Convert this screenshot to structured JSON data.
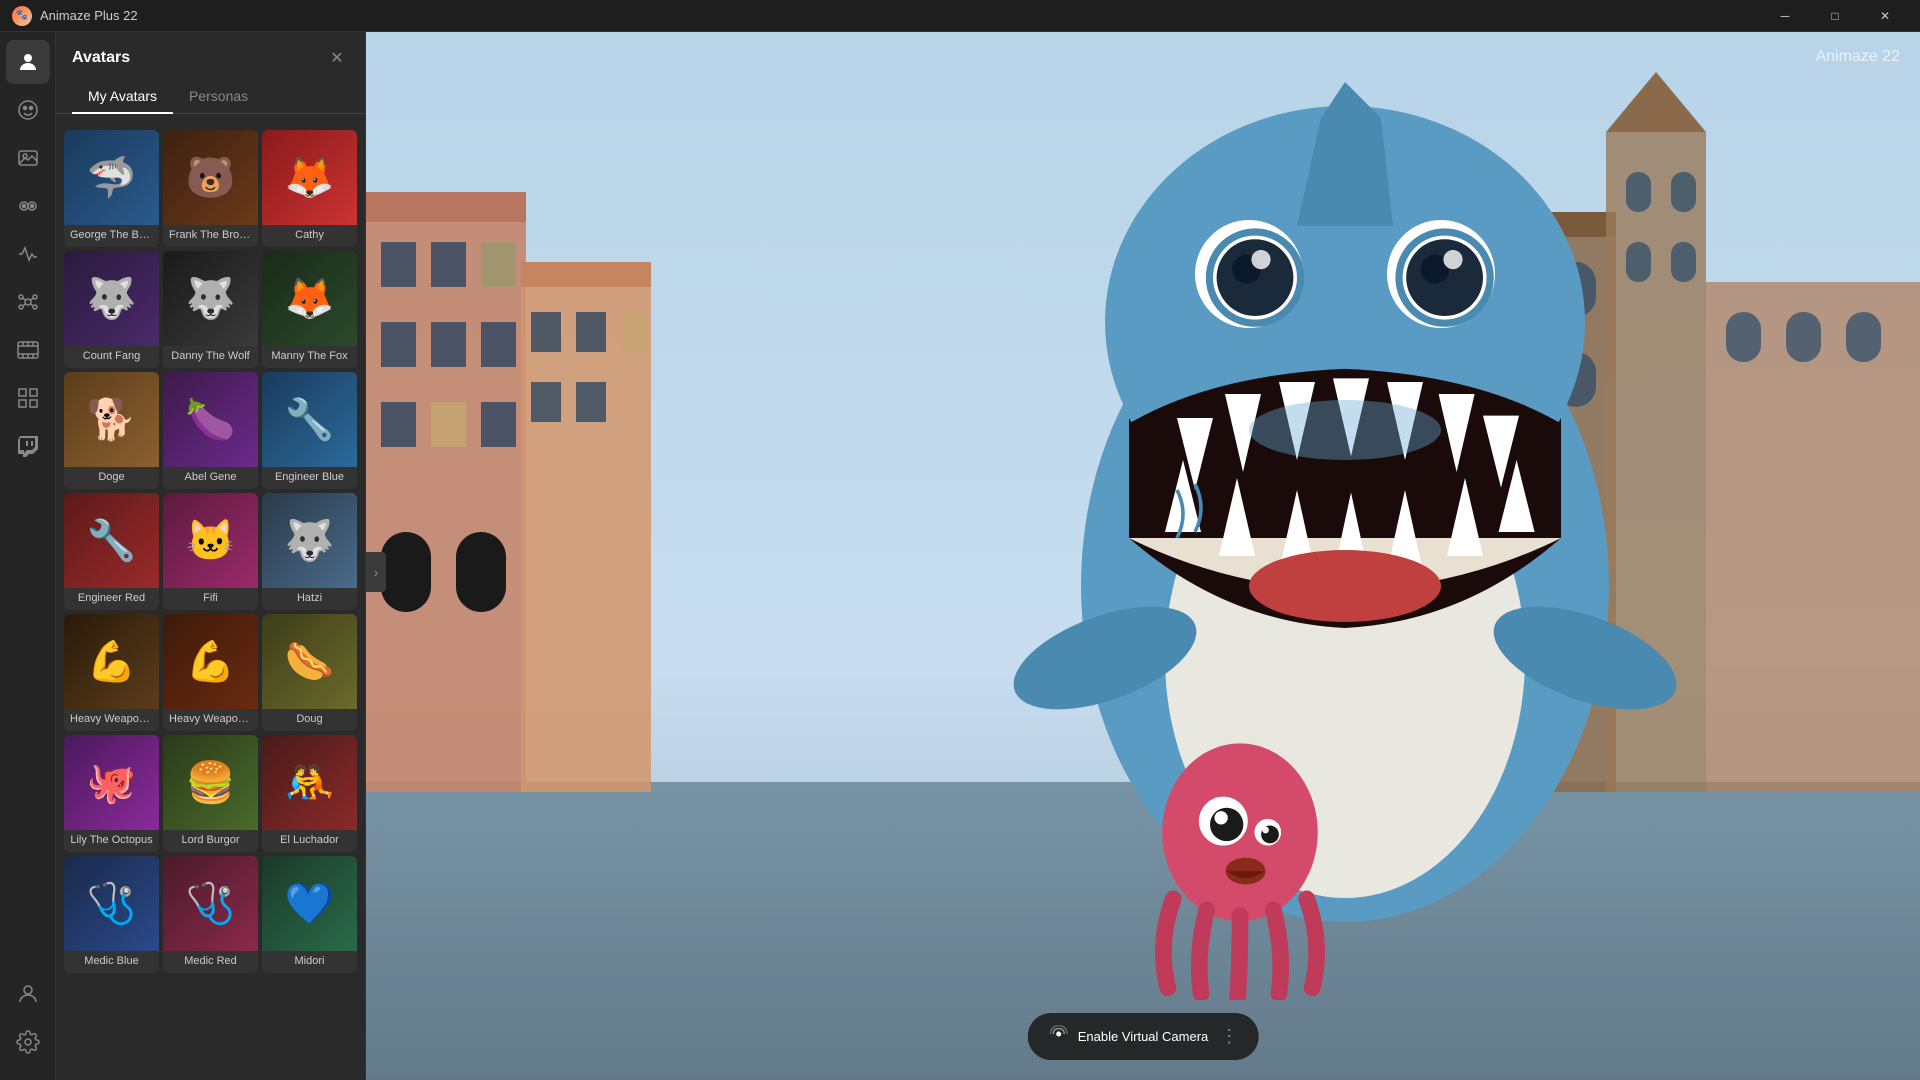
{
  "app": {
    "title": "Animaze Plus 22",
    "top_right_label": "Animaze 22"
  },
  "titlebar": {
    "minimize_label": "─",
    "maximize_label": "□",
    "close_label": "✕"
  },
  "sidebar": {
    "items": [
      {
        "id": "avatar",
        "icon": "🐾",
        "label": "Avatar"
      },
      {
        "id": "face",
        "icon": "😀",
        "label": "Face"
      },
      {
        "id": "scene",
        "icon": "🎬",
        "label": "Scene"
      },
      {
        "id": "eyes",
        "icon": "👁",
        "label": "Eyes"
      },
      {
        "id": "motion",
        "icon": "🎵",
        "label": "Motion"
      },
      {
        "id": "props",
        "icon": "🎭",
        "label": "Props"
      },
      {
        "id": "film",
        "icon": "🎞",
        "label": "Film"
      },
      {
        "id": "grid",
        "icon": "⊞",
        "label": "Grid"
      },
      {
        "id": "twitch",
        "icon": "📺",
        "label": "Twitch"
      }
    ],
    "bottom_items": [
      {
        "id": "user",
        "icon": "👤",
        "label": "User"
      },
      {
        "id": "settings",
        "icon": "⚙",
        "label": "Settings"
      }
    ]
  },
  "avatars_panel": {
    "title": "Avatars",
    "close_icon": "✕",
    "tabs": [
      {
        "id": "my-avatars",
        "label": "My Avatars",
        "active": true
      },
      {
        "id": "personas",
        "label": "Personas",
        "active": false
      }
    ],
    "avatars": [
      {
        "id": "george",
        "name": "George The Bo...",
        "icon": "🦈",
        "thumb_class": "thumb-george"
      },
      {
        "id": "frank",
        "name": "Frank The Brown...",
        "icon": "🐻",
        "thumb_class": "thumb-frank"
      },
      {
        "id": "cathy",
        "name": "Cathy",
        "icon": "🦊",
        "thumb_class": "thumb-cathy"
      },
      {
        "id": "count",
        "name": "Count Fang",
        "icon": "🐺",
        "thumb_class": "thumb-count"
      },
      {
        "id": "danny",
        "name": "Danny The Wolf",
        "icon": "🐺",
        "thumb_class": "thumb-danny"
      },
      {
        "id": "manny",
        "name": "Manny The Fox",
        "icon": "🦊",
        "thumb_class": "thumb-manny"
      },
      {
        "id": "doge",
        "name": "Doge",
        "icon": "🐕",
        "thumb_class": "thumb-doge"
      },
      {
        "id": "abel",
        "name": "Abel Gene",
        "icon": "🍆",
        "thumb_class": "thumb-abel"
      },
      {
        "id": "engblue",
        "name": "Engineer Blue",
        "icon": "🔧",
        "thumb_class": "thumb-engblue"
      },
      {
        "id": "engred",
        "name": "Engineer Red",
        "icon": "🔧",
        "thumb_class": "thumb-engred"
      },
      {
        "id": "fifi",
        "name": "Fifi",
        "icon": "🐱",
        "thumb_class": "thumb-fifi"
      },
      {
        "id": "hatzi",
        "name": "Hatzi",
        "icon": "🐺",
        "thumb_class": "thumb-hatzi"
      },
      {
        "id": "heavy1",
        "name": "Heavy Weapons...",
        "icon": "💪",
        "thumb_class": "thumb-heavy1"
      },
      {
        "id": "heavy2",
        "name": "Heavy Weapons...",
        "icon": "💪",
        "thumb_class": "thumb-heavy2"
      },
      {
        "id": "doug",
        "name": "Doug",
        "icon": "🌭",
        "thumb_class": "thumb-doug"
      },
      {
        "id": "lily",
        "name": "Lily The Octopus",
        "icon": "🐙",
        "thumb_class": "thumb-lily"
      },
      {
        "id": "lord",
        "name": "Lord Burgor",
        "icon": "🍔",
        "thumb_class": "thumb-lord"
      },
      {
        "id": "el",
        "name": "El Luchador",
        "icon": "🤼",
        "thumb_class": "thumb-el"
      },
      {
        "id": "medblue",
        "name": "Medic Blue",
        "icon": "🩺",
        "thumb_class": "thumb-medblue"
      },
      {
        "id": "medred",
        "name": "Medic Red",
        "icon": "🩺",
        "thumb_class": "thumb-medred"
      },
      {
        "id": "midori",
        "name": "Midori",
        "icon": "💙",
        "thumb_class": "thumb-midori"
      }
    ]
  },
  "bottom_toolbar": {
    "virtual_camera_label": "Enable Virtual Camera",
    "camera_icon": "📡",
    "dots_icon": "⋮"
  },
  "expand_btn": {
    "icon": "›"
  }
}
